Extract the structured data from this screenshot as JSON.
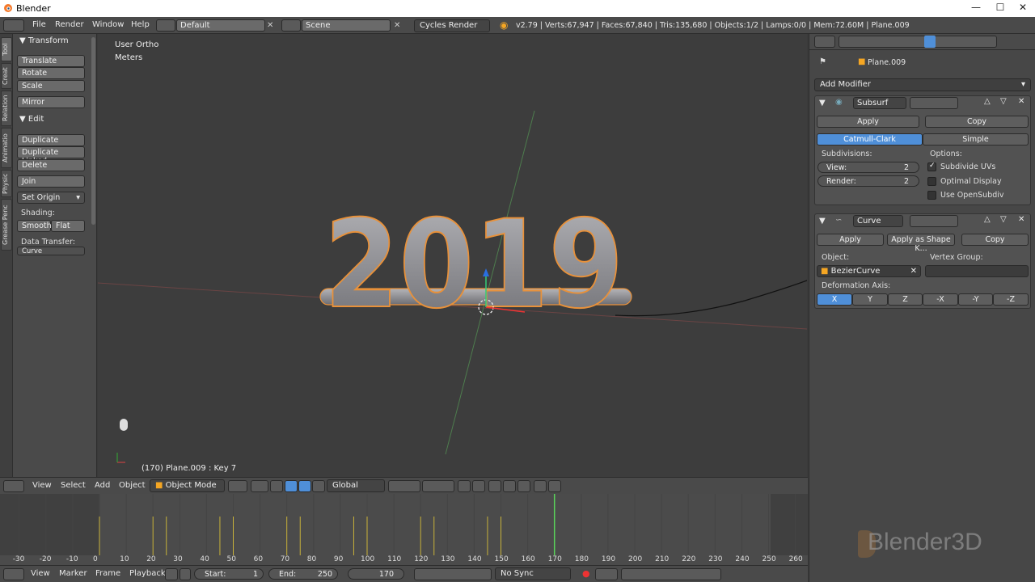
{
  "app": {
    "title": "Blender"
  },
  "topbar": {
    "menus": [
      "File",
      "Render",
      "Window",
      "Help"
    ],
    "layout": "Default",
    "scene": "Scene",
    "engine": "Cycles Render",
    "stats": "v2.79 | Verts:67,947 | Faces:67,840 | Tris:135,680 | Objects:1/2 | Lamps:0/0 | Mem:72.60M | Plane.009"
  },
  "toolshelf": {
    "tabs": [
      "Tool",
      "Creat",
      "Relation",
      "Animatio",
      "Physic",
      "Grease Penc"
    ],
    "transform": {
      "title": "Transform",
      "buttons": [
        "Translate",
        "Rotate",
        "Scale",
        "Mirror"
      ]
    },
    "edit": {
      "title": "Edit",
      "buttons": [
        "Duplicate",
        "Duplicate Linked",
        "Delete",
        "Join"
      ],
      "set_origin": "Set Origin",
      "shading_label": "Shading:",
      "smooth": "Smooth",
      "flat": "Flat",
      "data_transfer": "Data Transfer:",
      "curve": "Curve"
    }
  },
  "viewport": {
    "view_label": "User Ortho",
    "units": "Meters",
    "object_info": "(170) Plane.009 : Key 7",
    "text_3d": "2019"
  },
  "viewport_header": {
    "menus": [
      "View",
      "Select",
      "Add",
      "Object"
    ],
    "mode": "Object Mode",
    "orientation": "Global"
  },
  "timeline": {
    "ticks": [
      "-30",
      "-20",
      "-10",
      "0",
      "10",
      "20",
      "30",
      "40",
      "50",
      "60",
      "70",
      "80",
      "90",
      "100",
      "110",
      "120",
      "130",
      "140",
      "150",
      "160",
      "170",
      "180",
      "190",
      "200",
      "210",
      "220",
      "230",
      "240",
      "250",
      "260"
    ],
    "current_frame_value": 170,
    "keyframes": [
      0,
      20,
      25,
      45,
      50,
      70,
      75,
      95,
      100,
      120,
      125,
      145,
      150
    ]
  },
  "timeline_bar": {
    "menus": [
      "View",
      "Marker",
      "Frame",
      "Playback"
    ],
    "start_label": "Start:",
    "start": "1",
    "end_label": "End:",
    "end": "250",
    "current": "170",
    "sync": "No Sync"
  },
  "properties": {
    "object_name": "Plane.009",
    "add_modifier": "Add Modifier",
    "subsurf": {
      "name": "Subsurf",
      "apply": "Apply",
      "copy": "Copy",
      "types": [
        "Catmull-Clark",
        "Simple"
      ],
      "subdivisions_label": "Subdivisions:",
      "view_label": "View:",
      "view_value": "2",
      "render_label": "Render:",
      "render_value": "2",
      "options_label": "Options:",
      "opt_subdivide_uvs": "Subdivide UVs",
      "opt_optimal_display": "Optimal Display",
      "opt_use_opensubdiv": "Use OpenSubdiv"
    },
    "curve": {
      "name": "Curve",
      "apply": "Apply",
      "apply_shape": "Apply as Shape K...",
      "copy": "Copy",
      "object_label": "Object:",
      "object_value": "BezierCurve",
      "vertex_group_label": "Vertex Group:",
      "deform_axis_label": "Deformation Axis:",
      "axes": [
        "X",
        "Y",
        "Z",
        "-X",
        "-Y",
        "-Z"
      ]
    }
  },
  "watermark": "Blender3D"
}
